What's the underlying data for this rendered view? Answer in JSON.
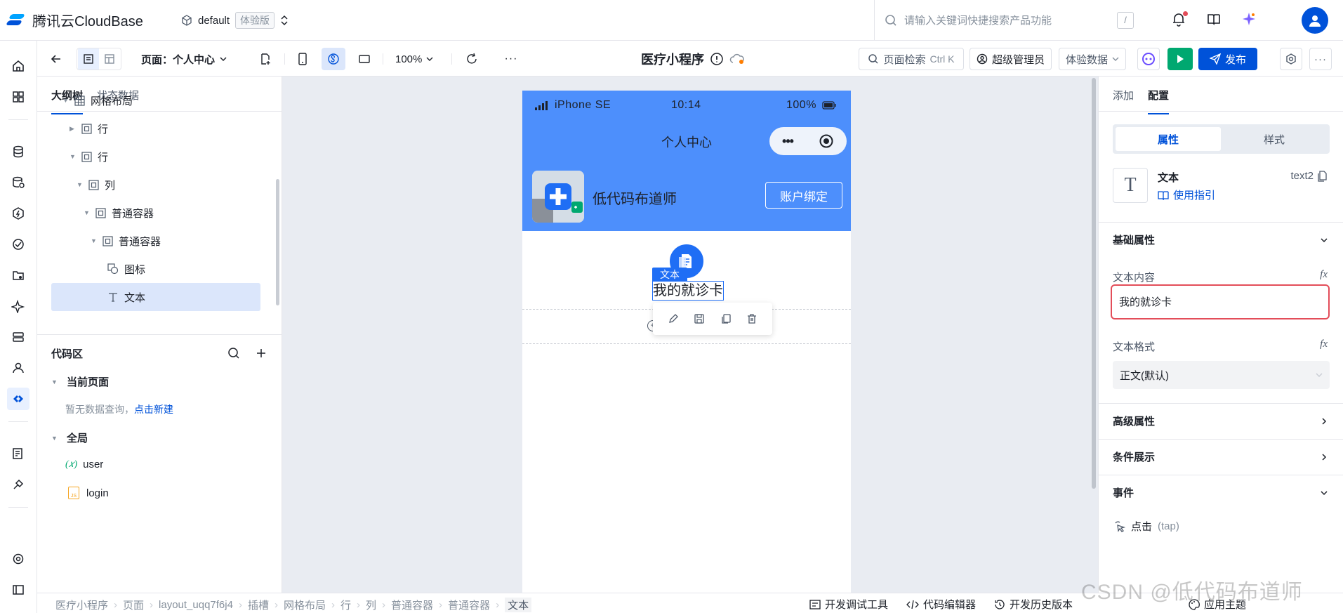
{
  "header": {
    "brand": "腾讯云CloudBase",
    "env_name": "default",
    "env_badge": "体验版",
    "search_placeholder": "请输入关键词快捷搜索产品功能",
    "search_shortcut": "/"
  },
  "rail": {
    "icons": [
      "home-icon",
      "grid-icon",
      "database-icon",
      "database-sync-icon",
      "function-icon",
      "cloud-run-icon",
      "storage-icon",
      "ai-icon",
      "model-icon",
      "user-icon",
      "lowcode-icon",
      "log-icon",
      "extension-icon",
      "settings-icon",
      "collapse-icon"
    ],
    "active": "lowcode-icon"
  },
  "toolbar": {
    "page_selector": "页面：个人中心",
    "zoom": "100%",
    "title": "医疗小程序",
    "page_search": "页面检索",
    "page_search_shortcut": "Ctrl K",
    "role": "超级管理员",
    "data_mode": "体验数据",
    "publish": "发布",
    "more": "···"
  },
  "outline": {
    "tabs": [
      "大纲树",
      "状态数据"
    ],
    "active_tab": "大纲树",
    "nodes": [
      {
        "label": "网格布局",
        "indent": 0,
        "arrow": "down",
        "icon": "grid-layout-icon"
      },
      {
        "label": "行",
        "indent": 1,
        "arrow": "right",
        "icon": "container-icon"
      },
      {
        "label": "行",
        "indent": 1,
        "arrow": "down",
        "icon": "container-icon"
      },
      {
        "label": "列",
        "indent": 2,
        "arrow": "down",
        "icon": "container-icon"
      },
      {
        "label": "普通容器",
        "indent": 3,
        "arrow": "down",
        "icon": "container-icon"
      },
      {
        "label": "普通容器",
        "indent": 4,
        "arrow": "down",
        "icon": "container-icon"
      },
      {
        "label": "图标",
        "indent": 5,
        "arrow": "",
        "icon": "icon-component-icon"
      },
      {
        "label": "文本",
        "indent": 5,
        "arrow": "",
        "icon": "text-icon",
        "selected": true
      }
    ]
  },
  "code_area": {
    "title": "代码区",
    "current_page": "当前页面",
    "empty_hint": "暂无数据查询，",
    "create_link": "点击新建",
    "global": "全局",
    "items": [
      {
        "prefix": "(𝑥)",
        "label": "user"
      },
      {
        "prefix": "JS",
        "label": "login"
      }
    ]
  },
  "phone": {
    "carrier": "iPhone SE",
    "time": "10:14",
    "battery": "100%",
    "nav_title": "个人中心",
    "user_name": "低代码布道师",
    "bind_button": "账户绑定",
    "selection_tag": "文本",
    "selected_text": "我的就诊卡"
  },
  "config_panel": {
    "tabs": [
      "添加",
      "配置"
    ],
    "active_tab": "配置",
    "segments": [
      "属性",
      "样式"
    ],
    "active_segment": "属性",
    "component_name": "文本",
    "component_id": "text2",
    "guide_link": "使用指引",
    "basic_section": "基础属性",
    "text_content_label": "文本内容",
    "text_content_value": "我的就诊卡",
    "text_format_label": "文本格式",
    "text_format_value": "正文(默认)",
    "advanced_section": "高级属性",
    "condition_section": "条件展示",
    "events_section": "事件",
    "event_tap": "点击",
    "event_tap_code": "(tap)",
    "fx": "fx"
  },
  "breadcrumb": [
    "医疗小程序",
    "页面",
    "layout_uqq7f6j4",
    "插槽",
    "网格布局",
    "行",
    "列",
    "普通容器",
    "普通容器",
    "文本"
  ],
  "bottom_tools": {
    "debug": "开发调试工具",
    "code_editor": "代码编辑器",
    "history": "开发历史版本",
    "theme": "应用主题"
  },
  "watermark": "CSDN @低代码布道师",
  "colors": {
    "primary": "#0052d9",
    "phone_header": "#4d8ffc",
    "run": "#00a870",
    "highlight_border": "#e34d59"
  }
}
